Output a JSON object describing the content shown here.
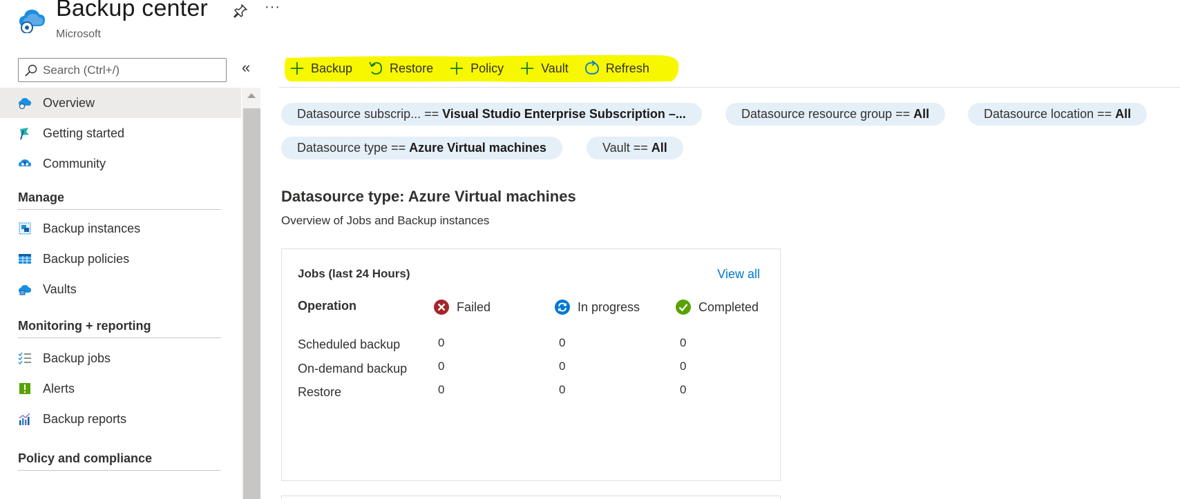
{
  "header": {
    "title": "Backup center",
    "subtitle": "Microsoft",
    "more_label": "···"
  },
  "sidebar": {
    "search_placeholder": "Search (Ctrl+/)",
    "collapse_label": "«",
    "items": [
      {
        "label": "Overview",
        "icon": "backup-center-icon",
        "selected": true
      },
      {
        "label": "Getting started",
        "icon": "getting-started-icon"
      },
      {
        "label": "Community",
        "icon": "community-icon"
      }
    ],
    "groups": [
      {
        "label": "Manage",
        "items": [
          {
            "label": "Backup instances",
            "icon": "backup-instances-icon"
          },
          {
            "label": "Backup policies",
            "icon": "backup-policies-icon"
          },
          {
            "label": "Vaults",
            "icon": "vaults-icon"
          }
        ]
      },
      {
        "label": "Monitoring + reporting",
        "items": [
          {
            "label": "Backup jobs",
            "icon": "backup-jobs-icon"
          },
          {
            "label": "Alerts",
            "icon": "alerts-icon"
          },
          {
            "label": "Backup reports",
            "icon": "backup-reports-icon"
          }
        ]
      },
      {
        "label": "Policy and compliance",
        "items": []
      }
    ]
  },
  "toolbar": {
    "highlight_color": "#f7f700",
    "buttons": [
      {
        "label": "Backup",
        "icon": "plus-icon"
      },
      {
        "label": "Restore",
        "icon": "restore-icon"
      },
      {
        "label": "Policy",
        "icon": "plus-icon"
      },
      {
        "label": "Vault",
        "icon": "plus-icon"
      },
      {
        "label": "Refresh",
        "icon": "refresh-icon"
      }
    ]
  },
  "filters": [
    {
      "key": "Datasource subscrip...  ==",
      "value": "Visual Studio Enterprise Subscription –..."
    },
    {
      "key": "Datasource resource group ==",
      "value": "All"
    },
    {
      "key": "Datasource location ==",
      "value": "All"
    },
    {
      "key": "Datasource type ==",
      "value": "Azure Virtual machines"
    },
    {
      "key": "Vault ==",
      "value": "All"
    }
  ],
  "section": {
    "title": "Datasource type: Azure Virtual machines",
    "subtitle": "Overview of Jobs and Backup instances"
  },
  "jobs_card": {
    "title": "Jobs (last 24 Hours)",
    "view_all": "View all",
    "columns": {
      "operation": "Operation",
      "failed": "Failed",
      "in_progress": "In progress",
      "completed": "Completed"
    },
    "rows": [
      {
        "operation": "Scheduled backup",
        "failed": "0",
        "in_progress": "0",
        "completed": "0"
      },
      {
        "operation": "On-demand backup",
        "failed": "0",
        "in_progress": "0",
        "completed": "0"
      },
      {
        "operation": "Restore",
        "failed": "0",
        "in_progress": "0",
        "completed": "0"
      }
    ],
    "colors": {
      "failed": "#a4262c",
      "in_progress": "#0078d4",
      "completed": "#57a300"
    }
  },
  "colors": {
    "accent": "#0078d4",
    "pill_bg": "#e5eff8",
    "selected_bg": "#edebe9"
  }
}
